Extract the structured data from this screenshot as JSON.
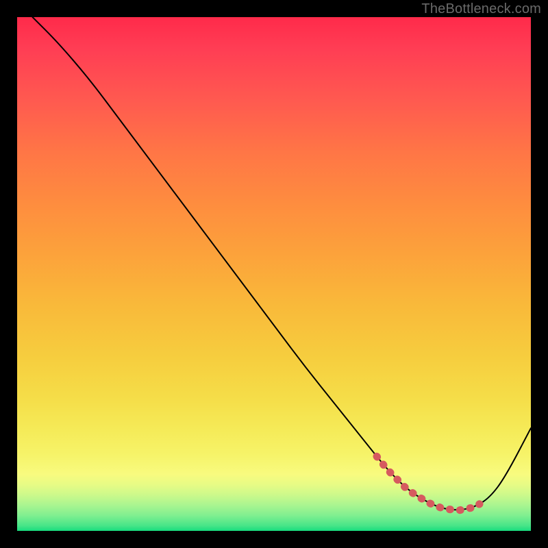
{
  "watermark": "TheBottleneck.com",
  "colors": {
    "background": "#000000",
    "curve": "#000000",
    "highlight": "#d65a5f"
  },
  "chart_data": {
    "type": "line",
    "title": "",
    "xlabel": "",
    "ylabel": "",
    "xlim": [
      0,
      100
    ],
    "ylim": [
      0,
      100
    ],
    "grid": false,
    "legend": false,
    "x": [
      3,
      8,
      14,
      20,
      26,
      32,
      38,
      44,
      50,
      56,
      62,
      68,
      72,
      76,
      80,
      83,
      86,
      89,
      92,
      95,
      100
    ],
    "series": [
      {
        "name": "bottleneck_curve",
        "values": [
          100,
          95,
          88,
          80,
          72,
          64,
          56,
          48,
          40,
          32,
          24.5,
          17,
          12,
          8,
          5.5,
          4.3,
          4,
          4.6,
          6.5,
          10.5,
          20
        ]
      }
    ],
    "highlight_range_x": [
      70,
      90
    ],
    "annotations": []
  }
}
